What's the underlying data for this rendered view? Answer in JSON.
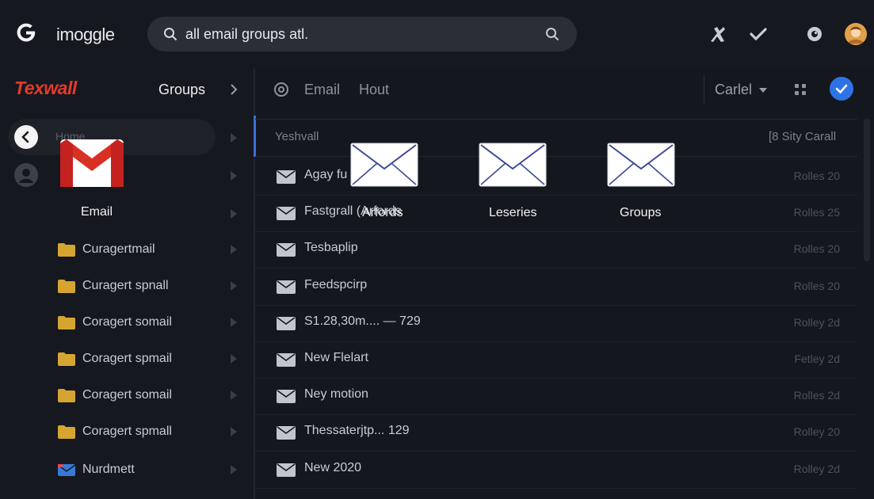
{
  "topbar": {
    "brand": "imoggle",
    "search_value": "all email groups atl.",
    "icons": [
      "tools-icon",
      "check-icon",
      "eye-icon",
      "avatar"
    ]
  },
  "sidebar": {
    "brand": "Texwall",
    "title": "Groups",
    "home_label": "Home",
    "email_label": "Email",
    "folders": [
      {
        "label": "Curagertmail",
        "icon": "folder-icon",
        "color": "#d6a531"
      },
      {
        "label": "Curagert spnall",
        "icon": "folder-icon",
        "color": "#d6a531"
      },
      {
        "label": "Coragert somail",
        "icon": "folder-icon",
        "color": "#d6a531"
      },
      {
        "label": "Coragert spmail",
        "icon": "folder-icon",
        "color": "#d6a531"
      },
      {
        "label": "Coragert somail",
        "icon": "folder-icon",
        "color": "#d6a531"
      },
      {
        "label": "Coragert spmall",
        "icon": "folder-icon",
        "color": "#d6a531"
      },
      {
        "label": "Nurdmett",
        "icon": "folder-icon",
        "color": "#3a78d8"
      }
    ]
  },
  "main": {
    "tabs": [
      "Email",
      "Hout"
    ],
    "sender_select": "Carlel",
    "list_header": {
      "left": "Yeshvall",
      "right": "[8 Sity Carall"
    },
    "rows": [
      {
        "sender": "Agay fu",
        "date": "Rolles 20"
      },
      {
        "sender": "Fastgrall (Arfords",
        "date": "Rolles 25"
      },
      {
        "sender": "Tesbaplip",
        "date": "Rolles 20"
      },
      {
        "sender": "Feedspcirp",
        "date": "Rolles 20"
      },
      {
        "sender": "S1.28,30m.... — 729",
        "date": "Rolley 2d"
      },
      {
        "sender": "New Flelart",
        "date": "Fetley 2d"
      },
      {
        "sender": "Ney motion",
        "date": "Rolles 2d"
      },
      {
        "sender": "Thessaterjtp... 129",
        "date": "Rolley 20"
      },
      {
        "sender": "New 2020",
        "date": "Rolley 2d"
      }
    ],
    "big_icons": [
      {
        "label": "Arfords",
        "icon": "envelope-icon"
      },
      {
        "label": "Leseries",
        "icon": "envelope-icon"
      },
      {
        "label": "Groups",
        "icon": "envelope-icon"
      }
    ]
  },
  "colors": {
    "accent": "#2d73e6",
    "brand_red": "#e23b2c",
    "folder_yellow": "#d6a531",
    "background": "#15171e"
  }
}
